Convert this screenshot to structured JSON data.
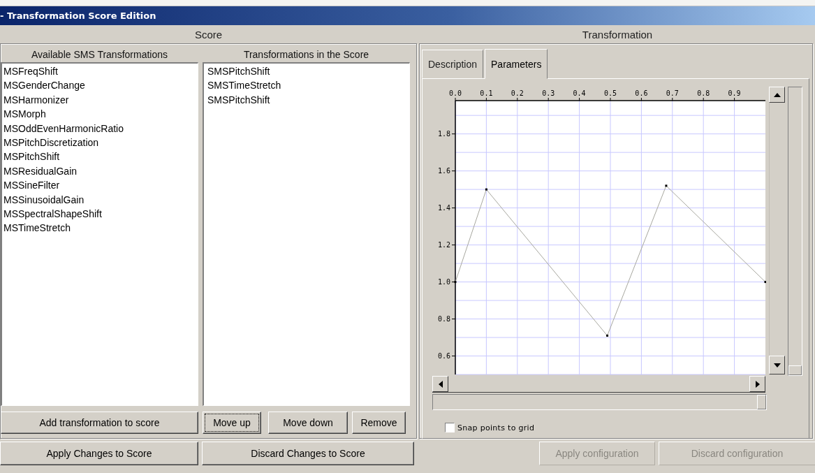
{
  "window": {
    "title": "- Transformation Score Edition"
  },
  "score": {
    "heading": "Score",
    "available": {
      "heading": "Available SMS Transformations",
      "items": [
        "MSFreqShift",
        "MSGenderChange",
        "MSHarmonizer",
        "MSMorph",
        "MSOddEvenHarmonicRatio",
        "MSPitchDiscretization",
        "MSPitchShift",
        "MSResidualGain",
        "MSSineFilter",
        "MSSinusoidalGain",
        "MSSpectralShapeShift",
        "MSTimeStretch"
      ]
    },
    "in_score": {
      "heading": "Transformations in the Score",
      "items": [
        "SMSPitchShift",
        "SMSTimeStretch",
        "SMSPitchShift"
      ]
    },
    "buttons": [
      {
        "label": "Add transformation to score",
        "focused": false
      },
      {
        "label": "Move up",
        "focused": true
      },
      {
        "label": "Move down",
        "focused": false
      },
      {
        "label": "Remove",
        "focused": false
      }
    ],
    "footer_buttons": [
      {
        "label": "Apply Changes to Score",
        "disabled": false
      },
      {
        "label": "Discard Changes to Score",
        "disabled": false
      }
    ]
  },
  "transformation": {
    "heading": "Transformation",
    "tabs": [
      {
        "label": "Description",
        "selected": false
      },
      {
        "label": "Parameters",
        "selected": true
      }
    ],
    "chart_data": {
      "type": "line",
      "grid": true,
      "xlim": [
        0,
        1
      ],
      "ylim": [
        0.5,
        1.98
      ],
      "xticks": [
        {
          "value": 0,
          "label": "0.0"
        },
        {
          "value": 0.1,
          "label": "0.1"
        },
        {
          "value": 0.2,
          "label": "0.2"
        },
        {
          "value": 0.3,
          "label": "0.3"
        },
        {
          "value": 0.4,
          "label": "0.4"
        },
        {
          "value": 0.5,
          "label": "0.5"
        },
        {
          "value": 0.6,
          "label": "0.6"
        },
        {
          "value": 0.7,
          "label": "0.7"
        },
        {
          "value": 0.8,
          "label": "0.8"
        },
        {
          "value": 0.9,
          "label": "0.9"
        }
      ],
      "yticks": [
        {
          "value": 0.6,
          "label": "0.6"
        },
        {
          "value": 0.8,
          "label": "0.8"
        },
        {
          "value": 1.0,
          "label": "1.0"
        },
        {
          "value": 1.2,
          "label": "1.2"
        },
        {
          "value": 1.4,
          "label": "1.4"
        },
        {
          "value": 1.6,
          "label": "1.6"
        },
        {
          "value": 1.8,
          "label": "1.8"
        }
      ],
      "x": [
        0,
        0.1,
        0.49,
        0.68,
        1.0
      ],
      "series": [
        {
          "color": "#a8a8a0",
          "marker": true,
          "values": [
            1.0,
            1.5,
            0.71,
            1.52,
            1.0
          ]
        }
      ]
    },
    "vertical_slider": {
      "level": 0
    },
    "horizontal_slider": {
      "level": 1
    },
    "snap_to_grid": {
      "label": "Snap points to grid",
      "checked": false
    },
    "buttons": [
      {
        "label": "Apply configuration",
        "disabled": true
      },
      {
        "label": "Discard configuration",
        "disabled": true
      }
    ]
  }
}
